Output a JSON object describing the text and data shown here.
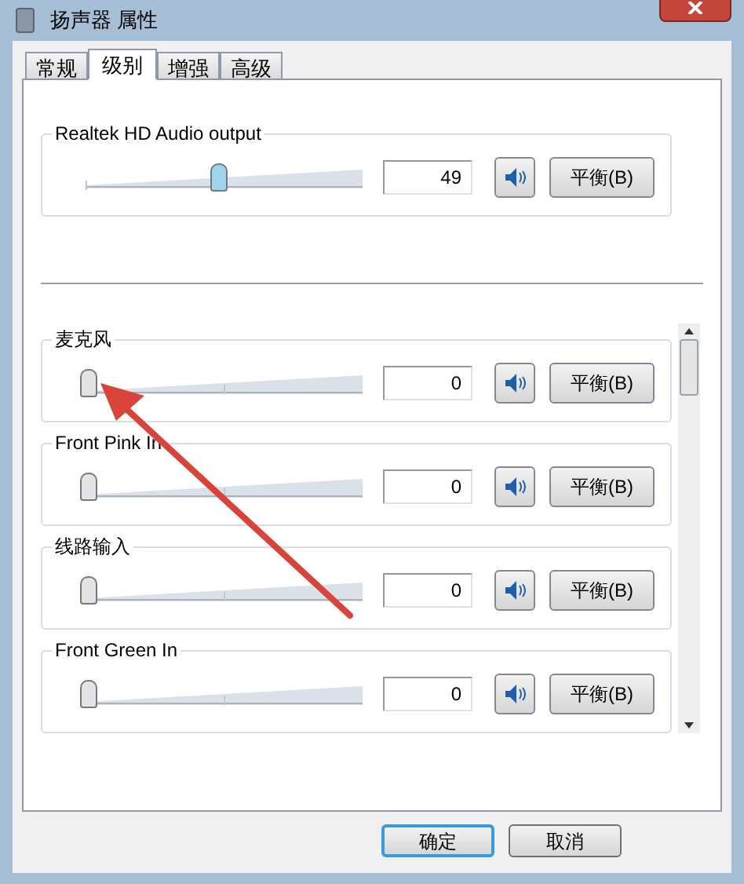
{
  "window": {
    "title": "扬声器 属性"
  },
  "tabs": [
    {
      "label": "常规",
      "selected": false
    },
    {
      "label": "级别",
      "selected": true
    },
    {
      "label": "增强",
      "selected": false
    },
    {
      "label": "高级",
      "selected": false
    }
  ],
  "master": {
    "name": "Realtek HD Audio output",
    "level": 0.49,
    "value": "49",
    "muted": false,
    "balance": "平衡(B)"
  },
  "inputs": [
    {
      "name": "麦克风",
      "level": 0,
      "value": "0",
      "muted": false,
      "balance": "平衡(B)"
    },
    {
      "name": "Front Pink In",
      "level": 0,
      "value": "0",
      "muted": false,
      "balance": "平衡(B)"
    },
    {
      "name": "线路输入",
      "level": 0,
      "value": "0",
      "muted": false,
      "balance": "平衡(B)"
    },
    {
      "name": "Front Green In",
      "level": 0,
      "value": "0",
      "muted": false,
      "balance": "平衡(B)"
    }
  ],
  "buttons": [
    {
      "label": "确定",
      "default": true
    },
    {
      "label": "取消",
      "default": false
    }
  ],
  "annotation": {
    "kind": "arrow"
  }
}
